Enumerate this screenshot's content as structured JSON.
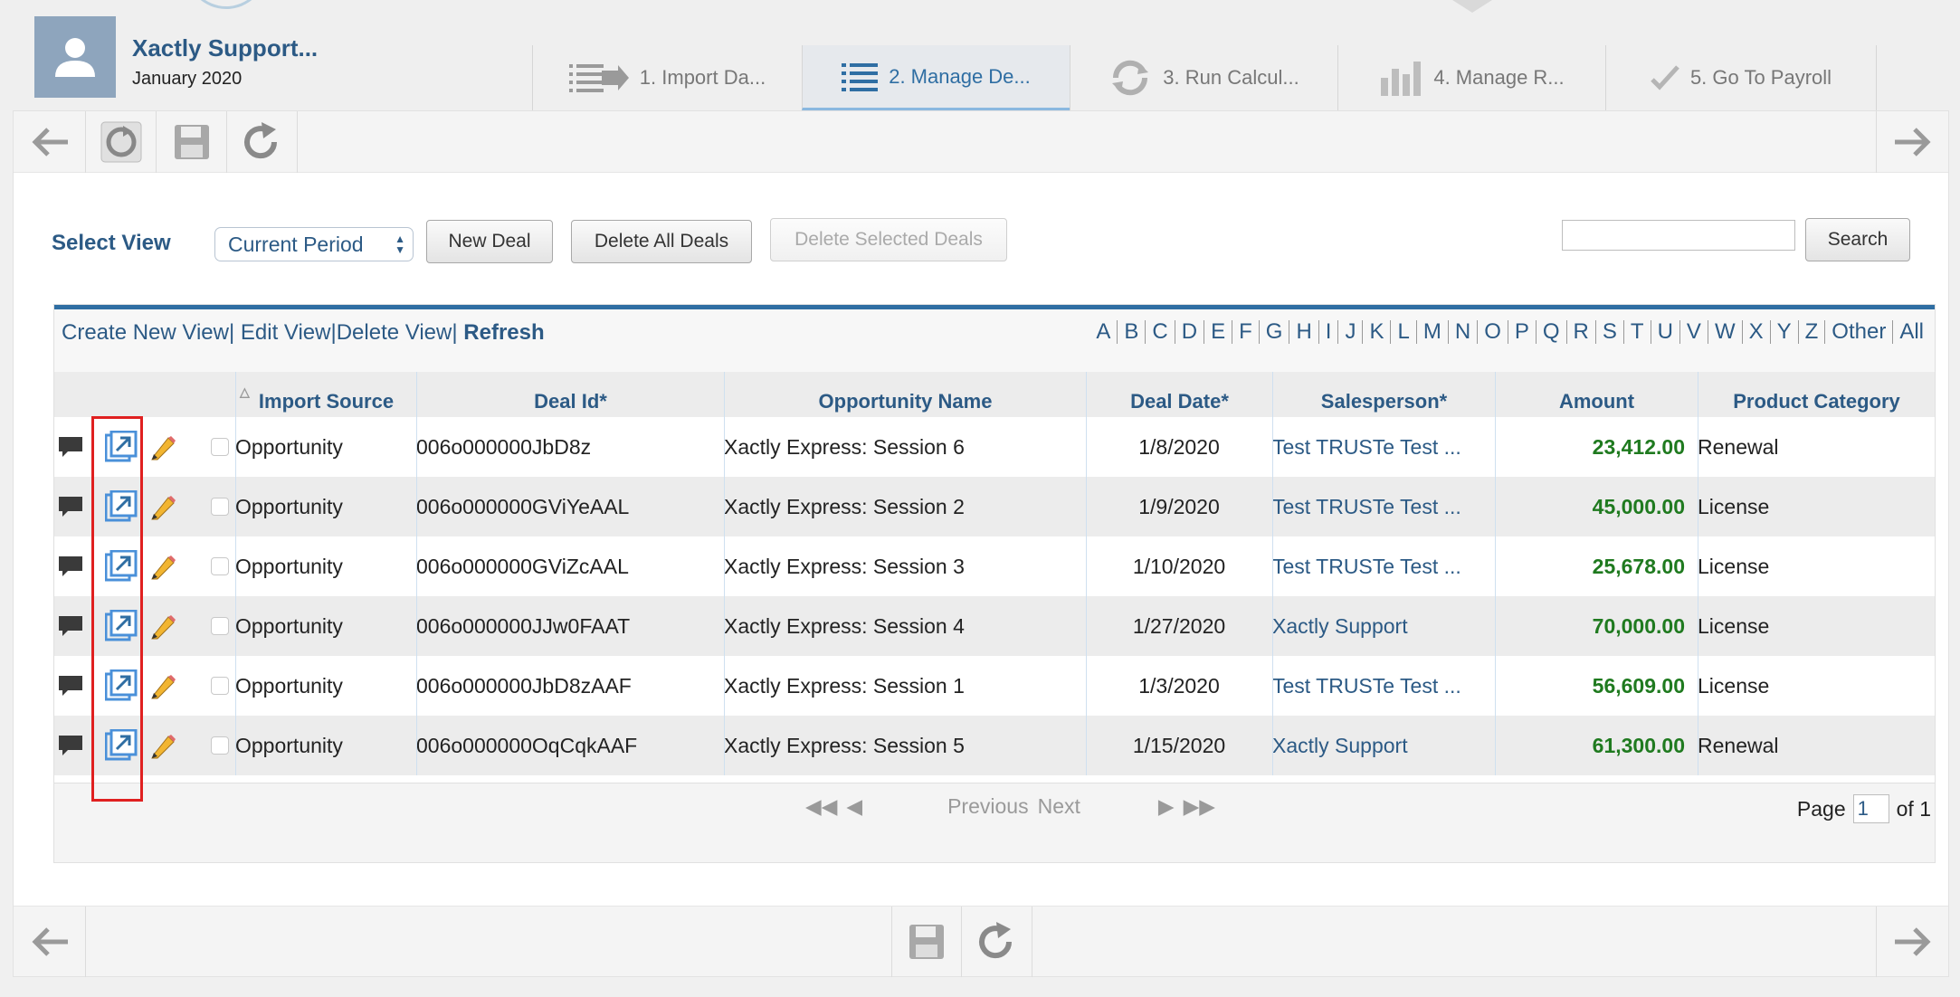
{
  "header": {
    "user_name": "Xactly Support...",
    "period": "January 2020",
    "steps": [
      {
        "label": "1. Import Da...",
        "icon": "import-icon"
      },
      {
        "label": "2. Manage De...",
        "icon": "list-icon",
        "active": true
      },
      {
        "label": "3. Run Calcul...",
        "icon": "refresh-cycle-icon"
      },
      {
        "label": "4. Manage R...",
        "icon": "bar-chart-icon"
      },
      {
        "label": "5. Go To Payroll",
        "icon": "checkmark-icon"
      }
    ]
  },
  "toolbar": {
    "icons": [
      "back-arrow-icon",
      "refresh-icon",
      "save-icon",
      "redo-icon",
      "forward-arrow-icon"
    ]
  },
  "controls": {
    "select_view_label": "Select View",
    "select_value": "Current Period",
    "new_deal": "New Deal",
    "delete_all": "Delete All Deals",
    "delete_selected": "Delete Selected Deals",
    "search_placeholder": "",
    "search_button": "Search"
  },
  "grid": {
    "view_links": {
      "create": "Create New View",
      "edit": "Edit View",
      "delete": "Delete View",
      "refresh": "Refresh"
    },
    "alphabet": [
      "A",
      "B",
      "C",
      "D",
      "E",
      "F",
      "G",
      "H",
      "I",
      "J",
      "K",
      "L",
      "M",
      "N",
      "O",
      "P",
      "Q",
      "R",
      "S",
      "T",
      "U",
      "V",
      "W",
      "X",
      "Y",
      "Z",
      "Other",
      "All"
    ],
    "columns": [
      "Import Source",
      "Deal Id*",
      "Opportunity Name",
      "Deal Date*",
      "Salesperson*",
      "Amount",
      "Product Category"
    ],
    "rows": [
      {
        "source": "Opportunity",
        "deal_id": "006o000000JbD8z",
        "opportunity": "Xactly Express: Session 6",
        "date": "1/8/2020",
        "salesperson": "Test TRUSTe Test ...",
        "amount": "23,412.00",
        "category": "Renewal"
      },
      {
        "source": "Opportunity",
        "deal_id": "006o000000GViYeAAL",
        "opportunity": "Xactly Express: Session 2",
        "date": "1/9/2020",
        "salesperson": "Test TRUSTe Test ...",
        "amount": "45,000.00",
        "category": "License"
      },
      {
        "source": "Opportunity",
        "deal_id": "006o000000GViZcAAL",
        "opportunity": "Xactly Express: Session 3",
        "date": "1/10/2020",
        "salesperson": "Test TRUSTe Test ...",
        "amount": "25,678.00",
        "category": "License"
      },
      {
        "source": "Opportunity",
        "deal_id": "006o000000JJw0FAAT",
        "opportunity": "Xactly Express: Session 4",
        "date": "1/27/2020",
        "salesperson": "Xactly Support",
        "amount": "70,000.00",
        "category": "License"
      },
      {
        "source": "Opportunity",
        "deal_id": "006o000000JbD8zAAF",
        "opportunity": "Xactly Express: Session 1",
        "date": "1/3/2020",
        "salesperson": "Test TRUSTe Test ...",
        "amount": "56,609.00",
        "category": "License"
      },
      {
        "source": "Opportunity",
        "deal_id": "006o000000OqCqkAAF",
        "opportunity": "Xactly Express: Session 5",
        "date": "1/15/2020",
        "salesperson": "Xactly Support",
        "amount": "61,300.00",
        "category": "Renewal"
      }
    ],
    "pager": {
      "previous": "Previous",
      "next": "Next",
      "page_label": "Page",
      "page_value": "1",
      "of_label": "of 1"
    }
  },
  "colors": {
    "accent": "#2f6ea3",
    "link": "#2c5a85",
    "amount": "#1f7a1f",
    "highlight": "#e02020"
  }
}
